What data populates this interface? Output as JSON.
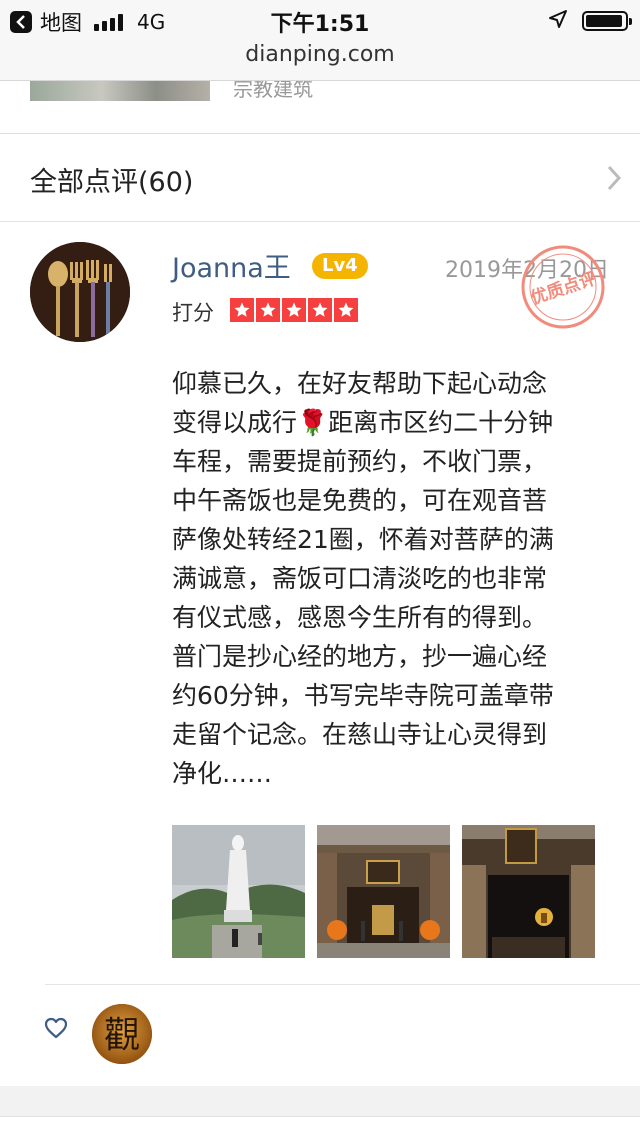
{
  "status_bar": {
    "back_app_label": "地图",
    "network": "4G",
    "time": "下午1:51",
    "url": "dianping.com",
    "icons": [
      "back-icon",
      "signal-icon",
      "location-arrow-icon",
      "battery-icon"
    ]
  },
  "previous_card": {
    "category_text": "宗教建筑"
  },
  "reviews_section": {
    "title": "全部点评(60)",
    "chevron_icon": "chevron-right-icon"
  },
  "review": {
    "username": "Joanna王",
    "level_badge": "Lv4",
    "date": "2019年2月20日",
    "quality_stamp": "优质点评",
    "score_label": "打分",
    "stars": 5,
    "star_color": "#f63f3f",
    "text_lines": [
      "仰慕已久，在好友帮助下起心动念",
      "变得以成行🌹距离市区约二十分钟",
      "车程，需要提前预约，不收门票，",
      "中午斋饭也是免费的，可在观音菩",
      "萨像处转经21圈，怀着对菩萨的满",
      "满诚意，斋饭可口清淡吃的也非常",
      "有仪式感，感恩今生所有的得到。",
      "普门是抄心经的地方，抄一遍心经",
      "约60分钟，书写完毕寺院可盖章带",
      "走留个记念。在慈山寺让心灵得到",
      "净化……"
    ],
    "photos": [
      "guanyin-statue-photo",
      "temple-hall-photo",
      "temple-gate-photo"
    ],
    "like_icon": "heart-icon",
    "liker_avatar_char": "觀"
  },
  "colors": {
    "username": "#3f5d83",
    "badge": "#f4b400",
    "stamp": "#f28b7b"
  }
}
